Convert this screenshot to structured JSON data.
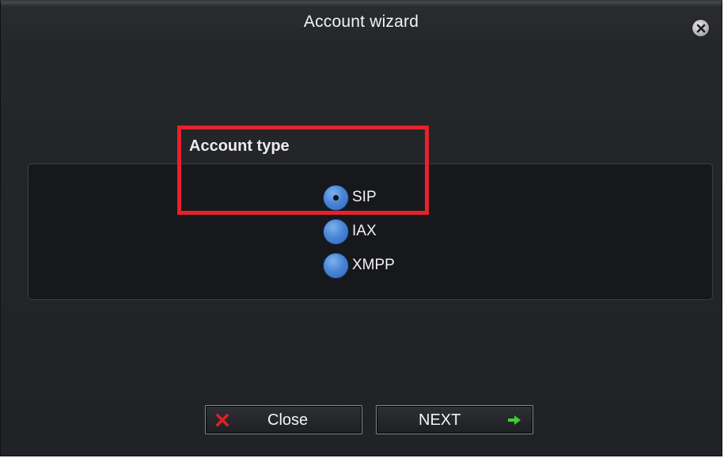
{
  "window": {
    "title": "Account wizard"
  },
  "section": {
    "label": "Account type"
  },
  "account_types": [
    {
      "label": "SIP",
      "selected": true
    },
    {
      "label": "IAX",
      "selected": false
    },
    {
      "label": "XMPP",
      "selected": false
    }
  ],
  "buttons": {
    "close_label": "Close",
    "next_label": "NEXT"
  },
  "icons": {
    "window_close": "close-circle-icon",
    "close_button": "red-x-icon",
    "next_button": "green-right-arrow-icon"
  },
  "colors": {
    "highlight": "#e8212b",
    "radio_blue": "#4a86d6",
    "close_x": "#e02020",
    "next_arrow": "#3bd12c"
  }
}
